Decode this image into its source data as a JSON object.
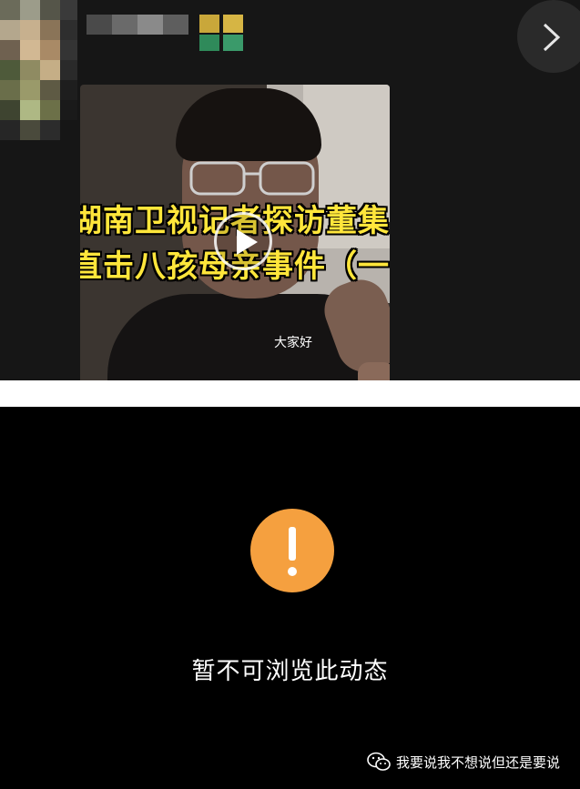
{
  "video": {
    "caption_line1": "湖南卫视记者探访董集",
    "caption_line2": "直击八孩母亲事件（一",
    "subtitle": "大家好"
  },
  "icons": {
    "next": "chevron-right-icon",
    "play": "play-icon",
    "warning": "exclamation-icon",
    "wechat": "wechat-icon"
  },
  "notice": {
    "message": "暂不可浏览此动态"
  },
  "footer": {
    "account_name": "我要说我不想说但还是要说"
  },
  "colors": {
    "caption": "#ffe63b",
    "warning": "#f5a03f",
    "background": "#000000"
  }
}
